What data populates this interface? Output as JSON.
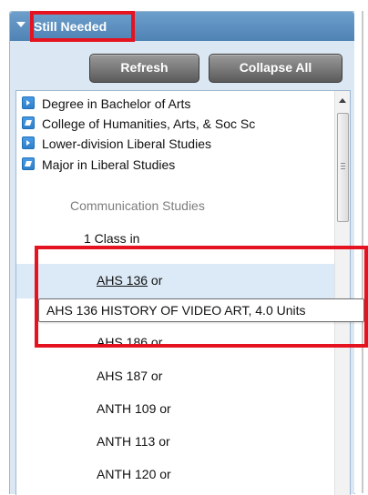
{
  "panel": {
    "title": "Still Needed",
    "buttons": {
      "refresh": "Refresh",
      "collapse_all": "Collapse All"
    }
  },
  "tree": {
    "items": [
      {
        "label": "Degree in Bachelor of Arts",
        "icon": "expand-icon"
      },
      {
        "label": "College of Humanities, Arts, & Soc Sc",
        "icon": "collapse-icon"
      },
      {
        "label": "Lower-division Liberal Studies",
        "icon": "expand-icon"
      },
      {
        "label": "Major in Liberal Studies",
        "icon": "collapse-icon"
      }
    ],
    "section": "Communication Studies",
    "requirement": "1 Class in",
    "courses": [
      {
        "code": "AHS 136",
        "suffix": " or"
      },
      {
        "code": "AHS 186",
        "suffix": " or"
      },
      {
        "code": "AHS 187",
        "suffix": " or"
      },
      {
        "code": "ANTH 109",
        "suffix": " or"
      },
      {
        "code": "ANTH 113",
        "suffix": " or"
      },
      {
        "code": "ANTH 120",
        "suffix": " or"
      }
    ]
  },
  "tooltip": {
    "text": "AHS 136 HISTORY OF VIDEO ART, 4.0 Units"
  },
  "colors": {
    "header_gradient_top": "#6d9fcc",
    "header_gradient_bottom": "#4f83b4",
    "panel_bg": "#dbe8f4",
    "selected_row": "#dceaf7",
    "highlight": "#e5131f"
  }
}
